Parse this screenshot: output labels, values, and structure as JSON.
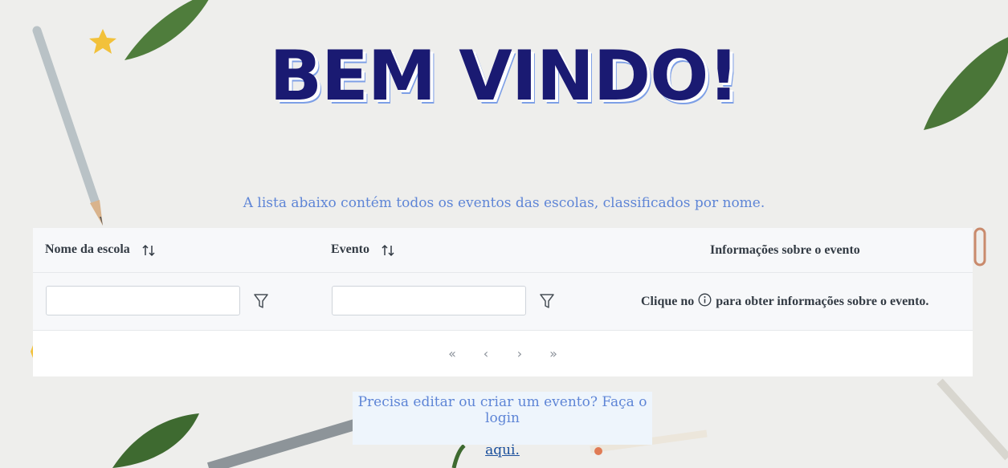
{
  "hero": {
    "title": "BEM VINDO!"
  },
  "subtitle": "A lista abaixo contém todos os eventos das escolas, classificados por nome.",
  "table": {
    "columns": [
      {
        "label": "Nome da escola",
        "sortable": true,
        "sort_icon": "sort-icon"
      },
      {
        "label": "Evento",
        "sortable": true,
        "sort_icon": "sort-icon"
      },
      {
        "label": "Informações sobre o evento",
        "sortable": false
      }
    ],
    "filters": {
      "school_value": "",
      "event_value": "",
      "filter_icon": "filter-icon"
    },
    "info": {
      "before": "Clique no",
      "icon": "info-circle-icon",
      "after": "para obter informações sobre o evento."
    }
  },
  "paginator": {
    "first": "«",
    "prev": "‹",
    "next": "›",
    "last": "»"
  },
  "login": {
    "text": "Precisa editar ou criar um evento? Faça o login",
    "link": "aqui."
  },
  "colors": {
    "hero": "#1a1a72",
    "accent": "#5e85d6",
    "link": "#1a4f9c"
  }
}
